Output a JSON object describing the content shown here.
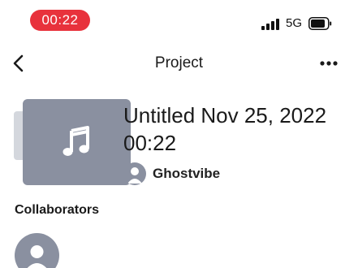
{
  "status_bar": {
    "time": "00:22",
    "network": "5G",
    "time_pill_color": "#e8323c"
  },
  "nav": {
    "title": "Project",
    "back_icon": "chevron-left-icon",
    "more_icon": "ellipsis-icon"
  },
  "project": {
    "title": "Untitled Nov 25, 2022 00:22",
    "cover_icon": "music-note-icon",
    "owner": "Ghostvibe",
    "cover_color": "#8a90a0"
  },
  "collaborators": {
    "heading": "Collaborators"
  }
}
